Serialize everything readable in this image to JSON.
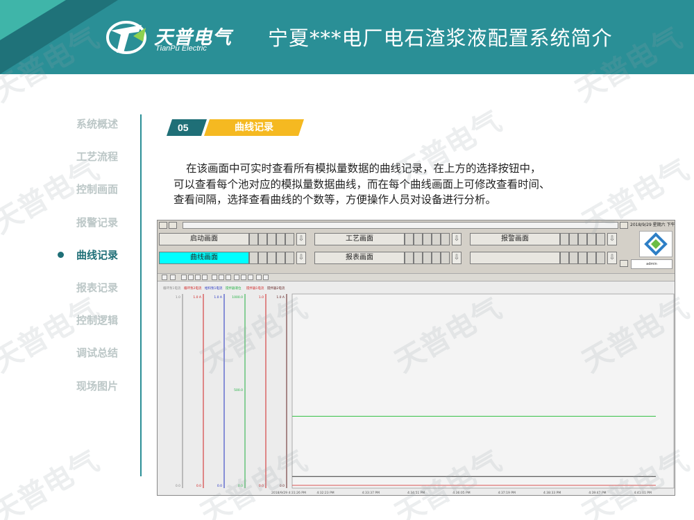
{
  "header": {
    "logo_cn": "天普电气",
    "logo_en": "TianPu Electric",
    "title": "宁夏***电厂电石渣浆液配置系统简介"
  },
  "watermark": "天普电气",
  "sidebar": {
    "items": [
      {
        "label": "系统概述"
      },
      {
        "label": "工艺流程"
      },
      {
        "label": "控制画面"
      },
      {
        "label": "报警记录"
      },
      {
        "label": "曲线记录"
      },
      {
        "label": "报表记录"
      },
      {
        "label": "控制逻辑"
      },
      {
        "label": "调试总结"
      },
      {
        "label": "现场图片"
      }
    ],
    "active_index": 4
  },
  "section": {
    "number": "05",
    "title": "曲线记录"
  },
  "description": {
    "lines": [
      "在该画面中可实时查看所有模拟量数据的曲线记录，在上方的选择按钮中，",
      "可以查看每个池对应的模拟量数据曲线，而在每个曲线画面上可修改查看时间、",
      "查看间隔，选择查看曲线的个数等，方便操作人员对设备进行分析。"
    ]
  },
  "scada": {
    "datetime": "2018/9/29 星期六 下午 04",
    "buttons_row1": [
      "启动画面",
      "工艺画面",
      "报警画面"
    ],
    "buttons_row2": [
      "曲线画面",
      "报表画面",
      ""
    ],
    "selected_button": "曲线画面",
    "user": "admin",
    "colors": {
      "selected": "#00ffff",
      "panel": "#d4d0c8"
    }
  },
  "chart_data": {
    "type": "line",
    "title": "",
    "series": [
      {
        "name": "循环泵1电流",
        "color": "#888888",
        "top": "1.0",
        "mid": "",
        "bottom": "0.0"
      },
      {
        "name": "循环泵2电流",
        "color": "#d02020",
        "top": "1.0 A",
        "mid": "",
        "bottom": "0.0"
      },
      {
        "name": "给料泵1电流",
        "color": "#2030c0",
        "top": "1.0 A",
        "mid": "",
        "bottom": "0.0"
      },
      {
        "name": "搅拌器液位",
        "color": "#20b040",
        "top": "1000.0",
        "mid": "500.0",
        "bottom": "0.0"
      },
      {
        "name": "搅拌器1电流",
        "color": "#d02020",
        "top": "1.0",
        "mid": "",
        "bottom": "0.0"
      },
      {
        "name": "搅拌器2电流",
        "color": "#602020",
        "top": "1.0 A",
        "mid": "",
        "bottom": "0.0"
      }
    ],
    "ylim": [
      0,
      1
    ],
    "series_values": {
      "green_level": 0.37,
      "dark_level": 0.06
    },
    "x_ticks": [
      "2018/9/29 4:31:26 PM",
      "4:32:23 PM",
      "4:33:37 PM",
      "4:34:51 PM",
      "4:36:05 PM",
      "4:37:19 PM",
      "4:38:33 PM",
      "4:39:47 PM",
      "4:41:01 PM"
    ]
  }
}
